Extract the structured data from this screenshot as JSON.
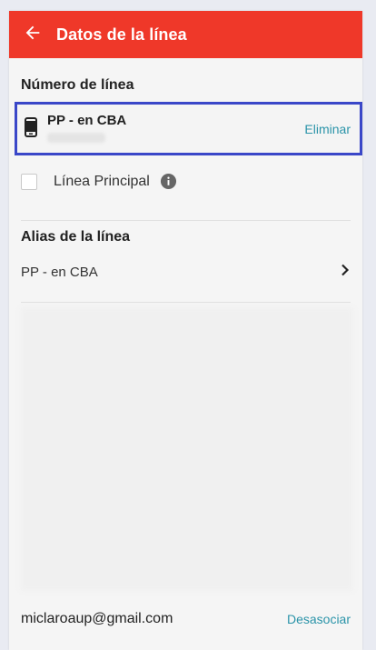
{
  "header": {
    "title": "Datos de la línea",
    "back_icon": "arrow-left-icon",
    "color": "#ef3829"
  },
  "line_number": {
    "section_label": "Número de línea",
    "line_name": "PP - en CBA",
    "icon": "mobile-phone-icon",
    "delete_label": "Eliminar",
    "highlight_color": "#3a47c8"
  },
  "principal": {
    "label": "Línea Principal",
    "checked": false,
    "info_icon": "info-icon"
  },
  "alias": {
    "section_label": "Alias de la línea",
    "value": "PP - en CBA",
    "chevron_icon": "chevron-right-icon"
  },
  "footer": {
    "email": "miclaroaup@gmail.com",
    "disassociate_label": "Desasociar",
    "link_color": "#2b94a9"
  }
}
